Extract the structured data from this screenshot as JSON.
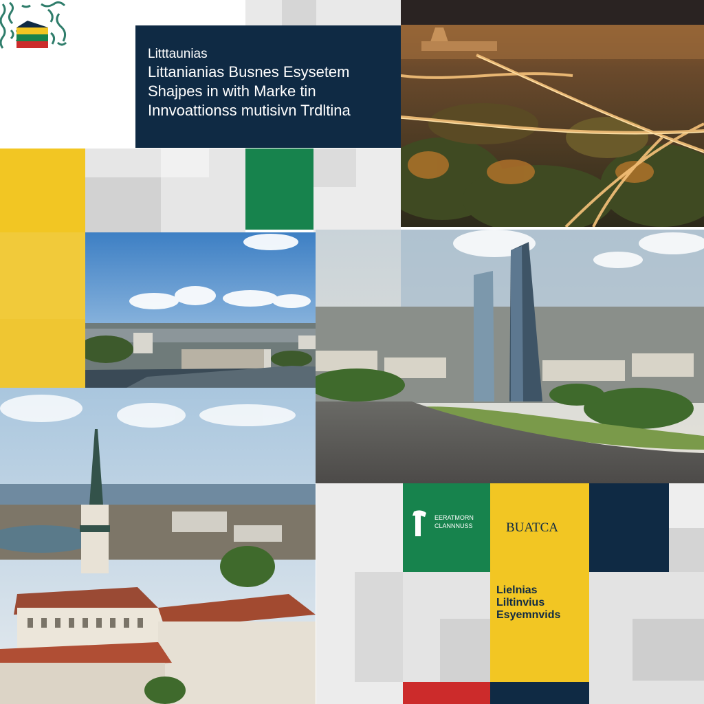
{
  "title": {
    "line1": "Litttaunias",
    "line2": "Littanianias Busnes Esysetem",
    "line3": "Shajpes in with Marke tin",
    "line4": "Innvoattionss mutisivn Trdltina"
  },
  "brand_panel": {
    "line1": "EERATMORN",
    "line2": "CLANNNUSS"
  },
  "badge_text": "BUATCA",
  "yellow_panel": {
    "line1": "Lielnias",
    "line2": "Liltinvius",
    "line3": "Esyemnvids"
  },
  "colors": {
    "navy": "#0f2a44",
    "green": "#17834d",
    "yellow": "#f2c623",
    "red": "#cc2b2b",
    "light_gray": "#e8e8e8",
    "mid_gray": "#cfcfcf"
  },
  "icons": {
    "logo": "folk-pattern-flag-logo",
    "brand": "column-emblem-icon"
  }
}
